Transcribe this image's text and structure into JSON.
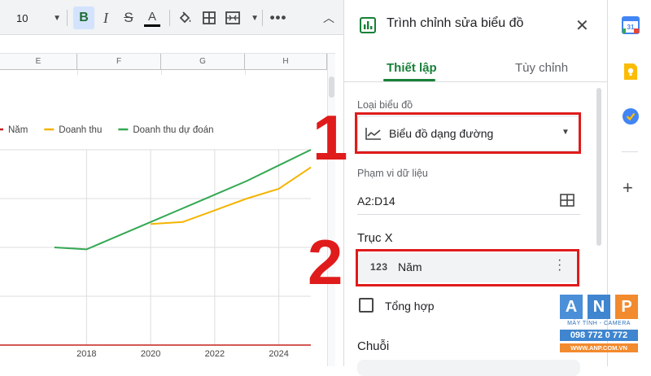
{
  "toolbar": {
    "font_size": "10",
    "bold": "B",
    "italic": "I",
    "strikethrough": "S",
    "text_color": "A",
    "text_color_hex": "#000000",
    "icons": [
      "chevron-down-icon",
      "fill-color-icon",
      "borders-icon",
      "merge-cells-icon",
      "more-icon",
      "collapse-icon"
    ]
  },
  "sheet": {
    "columns": [
      "E",
      "F",
      "G",
      "H"
    ]
  },
  "chart_data": {
    "type": "line",
    "x": [
      2016,
      2017,
      2018,
      2019,
      2020,
      2021,
      2022,
      2023,
      2024,
      2025
    ],
    "x_ticks": [
      "2018",
      "2020",
      "2022",
      "2024"
    ],
    "xlim": [
      2015.3,
      2025.0
    ],
    "ylim": [
      0,
      100
    ],
    "grid": true,
    "legend": "top-left",
    "series": [
      {
        "name": "Năm",
        "color": "#c5221f",
        "values": []
      },
      {
        "name": "Doanh thu",
        "color": "#f4b400",
        "values": [
          null,
          null,
          null,
          null,
          62,
          63,
          69,
          75,
          80,
          91
        ]
      },
      {
        "name": "Doanh thu dự đoán",
        "color": "#34a853",
        "values": [
          null,
          50,
          49,
          56,
          63,
          70,
          77,
          84,
          92,
          100
        ]
      }
    ]
  },
  "panel": {
    "title": "Trình chỉnh sửa biểu đồ",
    "tabs": [
      {
        "label": "Thiết lập",
        "active": true
      },
      {
        "label": "Tùy chỉnh",
        "active": false
      }
    ],
    "chart_type_label": "Loại biểu đồ",
    "chart_type_value": "Biểu đồ dạng đường",
    "data_range_label": "Phạm vi dữ liệu",
    "data_range_value": "A2:D14",
    "x_axis_label": "Trục X",
    "x_axis_icon_text": "123",
    "x_axis_value": "Năm",
    "aggregate_label": "Tổng hợp",
    "series_label": "Chuỗi"
  },
  "annotations": {
    "step_1": "1",
    "step_2": "2",
    "highlight_color": "#e01b1b"
  },
  "apps_bar": {
    "calendar_day": "31",
    "icons": [
      "calendar-icon",
      "keep-icon",
      "tasks-icon",
      "add-icon"
    ]
  },
  "watermark": {
    "letters": [
      "A",
      "N",
      "P"
    ],
    "tagline": "MÁY TÍNH - CAMERA",
    "phone": "098 772 0 772",
    "website": "WWW.ANP.COM.VN"
  }
}
